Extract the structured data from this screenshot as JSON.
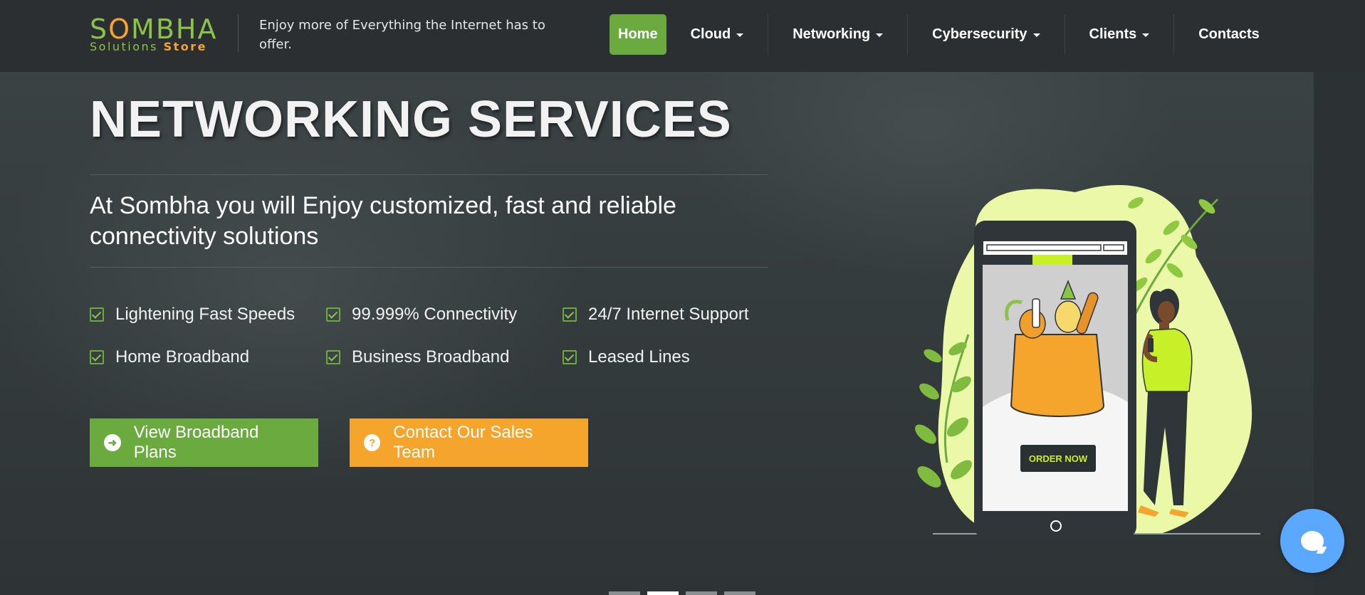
{
  "header": {
    "logo": {
      "main_before": "S",
      "main_o": "O",
      "main_after": "MBHA",
      "sub": "Solutions",
      "sub_store": "Store"
    },
    "tagline": "Enjoy more of Everything the Internet has to offer.",
    "nav": [
      {
        "label": "Home",
        "active": true,
        "dropdown": false
      },
      {
        "label": "Cloud",
        "dropdown": true
      },
      {
        "label": "Networking",
        "dropdown": true
      },
      {
        "label": "Cybersecurity",
        "dropdown": true
      },
      {
        "label": "Clients",
        "dropdown": true
      },
      {
        "label": "Contacts",
        "dropdown": false
      }
    ]
  },
  "hero": {
    "title": "NETWORKING SERVICES",
    "subtitle": "At Sombha you will Enjoy customized, fast and reliable connectivity solutions",
    "features": [
      "Lightening Fast Speeds",
      "99.999% Connectivity",
      "24/7 Internet Support",
      "Home Broadband",
      "Business Broadband",
      "Leased Lines"
    ],
    "buttons": {
      "primary": "View Broadband Plans",
      "secondary": "Contact Our Sales Team"
    },
    "illustration": {
      "order_button": "ORDER NOW"
    },
    "slides": {
      "count": 4,
      "active_index": 1
    }
  },
  "colors": {
    "accent_green": "#6aaa3f",
    "accent_orange": "#f5a42c",
    "chat_blue": "#5aa8ff",
    "nav_bg": "#2b2f31"
  },
  "icons": {
    "feature_check": "check-square-icon",
    "primary_button": "arrow-circle-right-icon",
    "secondary_button": "question-circle-icon",
    "dropdown": "caret-down-icon",
    "chat": "chat-bubble-icon"
  }
}
